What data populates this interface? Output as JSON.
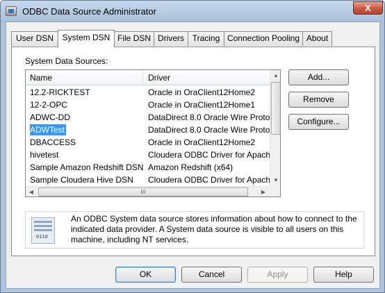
{
  "window": {
    "title": "ODBC Data Source Administrator",
    "close_glyph": "X"
  },
  "tabs": [
    {
      "label": "User DSN",
      "active": false
    },
    {
      "label": "System DSN",
      "active": true
    },
    {
      "label": "File DSN",
      "active": false
    },
    {
      "label": "Drivers",
      "active": false
    },
    {
      "label": "Tracing",
      "active": false
    },
    {
      "label": "Connection Pooling",
      "active": false
    },
    {
      "label": "About",
      "active": false
    }
  ],
  "system_dsn": {
    "section_label": "System Data Sources:",
    "columns": {
      "name": "Name",
      "driver": "Driver"
    },
    "rows": [
      {
        "name": "12.2-RICKTEST",
        "driver": "Oracle in OraClient12Home2",
        "selected": false
      },
      {
        "name": "12-2-OPC",
        "driver": "Oracle in OraClient12Home1",
        "selected": false
      },
      {
        "name": "ADWC-DD",
        "driver": "DataDirect 8.0 Oracle Wire Proto",
        "selected": false
      },
      {
        "name": "ADWTest",
        "driver": "DataDirect 8.0 Oracle Wire Proto",
        "selected": true
      },
      {
        "name": "DBACCESS",
        "driver": "Oracle in OraClient12Home2",
        "selected": false
      },
      {
        "name": "hivetest",
        "driver": "Cloudera ODBC Driver for Apach",
        "selected": false
      },
      {
        "name": "Sample Amazon Redshift DSN",
        "driver": "Amazon Redshift (x64)",
        "selected": false
      },
      {
        "name": "Sample Cloudera Hive DSN",
        "driver": "Cloudera ODBC Driver for Apach",
        "selected": false
      }
    ],
    "buttons": {
      "add": "Add...",
      "remove": "Remove",
      "configure": "Configure..."
    },
    "info_text": "An ODBC System data source stores information about how to connect to the indicated data provider.  A System data source is visible to all users on this machine, including NT services.",
    "scrollbar_glyphs": {
      "up": "▲",
      "down": "▼",
      "left": "◀",
      "right": "▶",
      "grip": "III"
    }
  },
  "dialog_buttons": {
    "ok": "OK",
    "cancel": "Cancel",
    "apply": "Apply",
    "help": "Help"
  },
  "colors": {
    "selection": "#3399ff",
    "window_frame": "#aec3db",
    "close_button": "#c75c47"
  },
  "icons": {
    "app": "odbc-administrator-icon",
    "info": "data-source-info-icon"
  }
}
